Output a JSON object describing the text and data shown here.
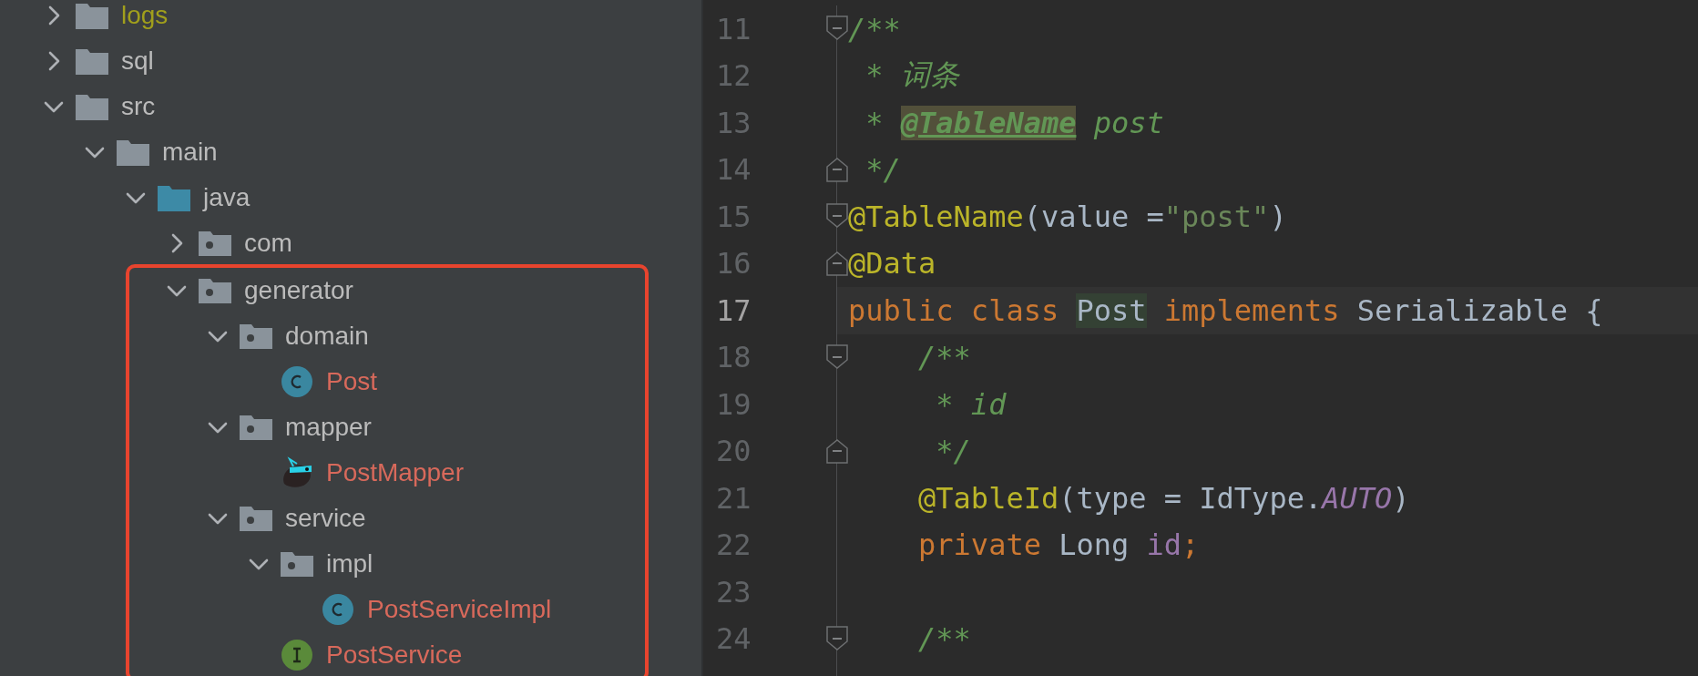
{
  "project_tree": {
    "items": [
      {
        "name": "logs",
        "kind": "folder",
        "color": "#a19f1c",
        "expanded": false
      },
      {
        "name": "sql",
        "kind": "folder",
        "color": "#bbbbbb",
        "expanded": false
      },
      {
        "name": "src",
        "kind": "folder",
        "color": "#bbbbbb",
        "expanded": true,
        "children": [
          {
            "name": "main",
            "kind": "folder",
            "color": "#bbbbbb",
            "expanded": true,
            "children": [
              {
                "name": "java",
                "kind": "source_folder",
                "color": "#bbbbbb",
                "expanded": true,
                "children": [
                  {
                    "name": "com",
                    "kind": "package",
                    "color": "#bbbbbb",
                    "expanded": false
                  },
                  {
                    "name": "generator",
                    "kind": "package",
                    "color": "#bbbbbb",
                    "expanded": true,
                    "framed": true,
                    "children": [
                      {
                        "name": "domain",
                        "kind": "package",
                        "color": "#bbbbbb",
                        "expanded": true,
                        "children": [
                          {
                            "name": "Post",
                            "kind": "class",
                            "color": "#d8695b"
                          }
                        ]
                      },
                      {
                        "name": "mapper",
                        "kind": "package",
                        "color": "#bbbbbb",
                        "expanded": true,
                        "children": [
                          {
                            "name": "PostMapper",
                            "kind": "mapper",
                            "color": "#d8695b"
                          }
                        ]
                      },
                      {
                        "name": "service",
                        "kind": "package",
                        "color": "#bbbbbb",
                        "expanded": true,
                        "children": [
                          {
                            "name": "impl",
                            "kind": "package",
                            "color": "#bbbbbb",
                            "expanded": true,
                            "children": [
                              {
                                "name": "PostServiceImpl",
                                "kind": "class",
                                "color": "#d8695b"
                              }
                            ]
                          },
                          {
                            "name": "PostService",
                            "kind": "interface",
                            "color": "#d8695b"
                          }
                        ]
                      }
                    ]
                  }
                ]
              }
            ]
          }
        ]
      }
    ]
  },
  "editor": {
    "lines": [
      {
        "number": "11",
        "current": false,
        "fold_start": true,
        "fold_end": false,
        "tokens": [
          {
            "kind": "comment",
            "text": "/**"
          }
        ]
      },
      {
        "number": "12",
        "current": false,
        "fold_start": false,
        "fold_end": false,
        "tokens": [
          {
            "kind": "comment",
            "text": " * 词条"
          }
        ]
      },
      {
        "number": "13",
        "current": false,
        "fold_start": false,
        "fold_end": false,
        "tokens": [
          {
            "kind": "comment",
            "text": " * "
          },
          {
            "kind": "doc_tag",
            "text": "@TableName"
          },
          {
            "kind": "comment",
            "text": " post"
          }
        ]
      },
      {
        "number": "14",
        "current": false,
        "fold_start": false,
        "fold_end": true,
        "tokens": [
          {
            "kind": "comment",
            "text": " */"
          }
        ]
      },
      {
        "number": "15",
        "current": false,
        "fold_start": true,
        "fold_end": false,
        "tokens": [
          {
            "kind": "annotation",
            "text": "@TableName"
          },
          {
            "kind": "plain",
            "text": "(value ="
          },
          {
            "kind": "string",
            "text": "\"post\""
          },
          {
            "kind": "plain",
            "text": ")"
          }
        ]
      },
      {
        "number": "16",
        "current": false,
        "fold_start": false,
        "fold_end": true,
        "tokens": [
          {
            "kind": "annotation",
            "text": "@Data"
          }
        ]
      },
      {
        "number": "17",
        "current": true,
        "fold_start": false,
        "fold_end": false,
        "tokens": [
          {
            "kind": "keyword",
            "text": "public class "
          },
          {
            "kind": "usage",
            "text": "Post"
          },
          {
            "kind": "keyword",
            "text": " implements "
          },
          {
            "kind": "plain",
            "text": "Serializable {"
          }
        ]
      },
      {
        "number": "18",
        "current": false,
        "fold_start": true,
        "fold_end": false,
        "tokens": [
          {
            "kind": "comment",
            "text": "    /**"
          }
        ]
      },
      {
        "number": "19",
        "current": false,
        "fold_start": false,
        "fold_end": false,
        "tokens": [
          {
            "kind": "comment",
            "text": "     * id"
          }
        ]
      },
      {
        "number": "20",
        "current": false,
        "fold_start": false,
        "fold_end": true,
        "tokens": [
          {
            "kind": "comment",
            "text": "     */"
          }
        ]
      },
      {
        "number": "21",
        "current": false,
        "fold_start": false,
        "fold_end": false,
        "tokens": [
          {
            "kind": "annotation",
            "text": "    @TableId"
          },
          {
            "kind": "plain",
            "text": "(type = IdType."
          },
          {
            "kind": "constant",
            "text": "AUTO"
          },
          {
            "kind": "plain",
            "text": ")"
          }
        ]
      },
      {
        "number": "22",
        "current": false,
        "fold_start": false,
        "fold_end": false,
        "tokens": [
          {
            "kind": "keyword",
            "text": "    private "
          },
          {
            "kind": "plain",
            "text": "Long "
          },
          {
            "kind": "field",
            "text": "id"
          },
          {
            "kind": "keyword",
            "text": ";"
          }
        ]
      },
      {
        "number": "23",
        "current": false,
        "fold_start": false,
        "fold_end": false
      },
      {
        "number": "24",
        "current": false,
        "fold_start": true,
        "fold_end": false,
        "tokens": [
          {
            "kind": "comment",
            "text": "    /**"
          }
        ]
      }
    ]
  }
}
